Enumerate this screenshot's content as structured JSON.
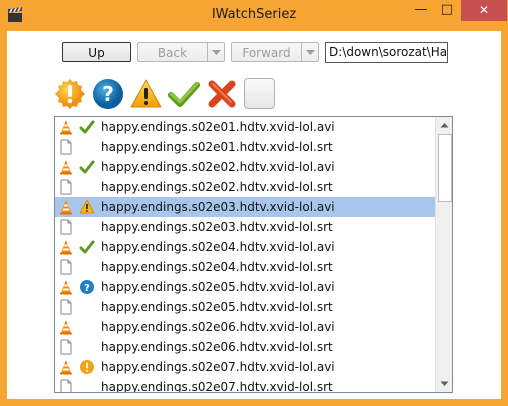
{
  "window": {
    "title": "IWatchSeriez",
    "minimize": "—",
    "maximize": "□",
    "close": "✕"
  },
  "toolbar": {
    "up_label": "Up",
    "back_label": "Back",
    "forward_label": "Forward",
    "path_value": "D:\\down\\sorozat\\Happ"
  },
  "icons": [
    "status-unknown-icon",
    "help-icon",
    "warning-icon",
    "check-icon",
    "delete-icon",
    "blank-button"
  ],
  "files": [
    {
      "name": "happy.endings.s02e01.hdtv.xvid-lol.avi",
      "type": "vlc-icon",
      "status": "check"
    },
    {
      "name": "happy.endings.s02e01.hdtv.xvid-lol.srt",
      "type": "file-icon",
      "status": ""
    },
    {
      "name": "happy.endings.s02e02.hdtv.xvid-lol.avi",
      "type": "vlc-icon",
      "status": "check"
    },
    {
      "name": "happy.endings.s02e02.hdtv.xvid-lol.srt",
      "type": "file-icon",
      "status": ""
    },
    {
      "name": "happy.endings.s02e03.hdtv.xvid-lol.avi",
      "type": "vlc-icon",
      "status": "warning",
      "selected": true
    },
    {
      "name": "happy.endings.s02e03.hdtv.xvid-lol.srt",
      "type": "file-icon",
      "status": ""
    },
    {
      "name": "happy.endings.s02e04.hdtv.xvid-lol.avi",
      "type": "vlc-icon",
      "status": "check"
    },
    {
      "name": "happy.endings.s02e04.hdtv.xvid-lol.srt",
      "type": "file-icon",
      "status": ""
    },
    {
      "name": "happy.endings.s02e05.hdtv.xvid-lol.avi",
      "type": "vlc-icon",
      "status": "help"
    },
    {
      "name": "happy.endings.s02e05.hdtv.xvid-lol.srt",
      "type": "file-icon",
      "status": ""
    },
    {
      "name": "happy.endings.s02e06.hdtv.xvid-lol.avi",
      "type": "vlc-icon",
      "status": ""
    },
    {
      "name": "happy.endings.s02e06.hdtv.xvid-lol.srt",
      "type": "file-icon",
      "status": ""
    },
    {
      "name": "happy.endings.s02e07.hdtv.xvid-lol.avi",
      "type": "vlc-icon",
      "status": "unknown"
    },
    {
      "name": "happy.endings.s02e07.hdtv.xvid-lol.srt",
      "type": "file-icon",
      "status": ""
    }
  ],
  "colors": {
    "titlebar": "#f6a533",
    "selection": "#a8c6ec",
    "close": "#c74f4f"
  }
}
